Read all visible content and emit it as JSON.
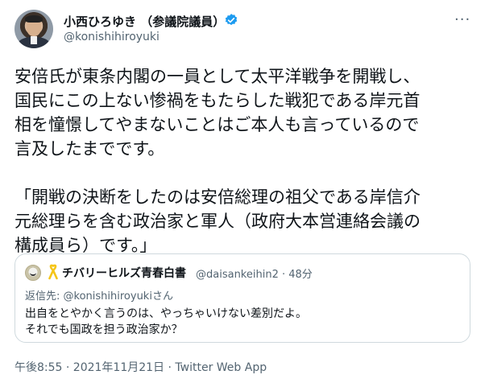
{
  "author": {
    "name": "小西ひろゆき （参議院議員）",
    "handle": "@konishihiroyuki",
    "verified_icon": "verified-badge-icon",
    "accent": "#1d9bf0"
  },
  "more_label": "···",
  "tweet": {
    "paragraphs": [
      "安倍氏が東条内閣の一員として太平洋戦争を開戦し、",
      "国民にこの上ない惨禍をもたらした戦犯である岸元首",
      "相を憧憬してやまないことはご本人も言っているので",
      "言及したまでです。",
      "",
      "「開戦の決断をしたのは安倍総理の祖父である岸信介",
      "元総理らを含む政治家と軍人（政府大本営連絡会議の",
      "構成員ら）です。」"
    ]
  },
  "quoted": {
    "name": "チバリーヒルズ青春白書",
    "handle_time": "@daisankeihin2 · 48分",
    "reply_prefix": "返信先: ",
    "reply_mention": "@konishihiroyuki",
    "reply_suffix": "さん",
    "text_lines": [
      "出自をとやかく言うのは、やっちゃいけない差別だよ。",
      "それでも国政を担う政治家か？"
    ],
    "ribbon_color": "#f5c518"
  },
  "meta": {
    "time": "午後8:55 · 2021年11月21日 · ",
    "app": "Twitter Web App"
  }
}
